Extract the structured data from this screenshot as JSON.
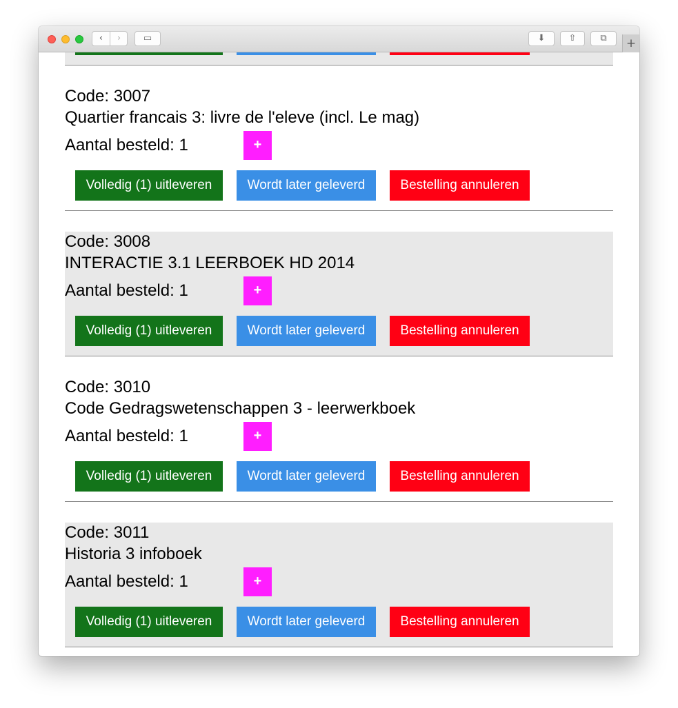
{
  "browser": {
    "nav_back_icon": "‹",
    "nav_forward_icon": "›",
    "sidebar_icon": "▭",
    "download_icon": "⬇",
    "share_icon": "⇧",
    "tabs_icon": "⧉",
    "new_tab_icon": "+"
  },
  "labels": {
    "code_prefix": "Code: ",
    "quantity_label": "Aantal besteld: ",
    "plus": "+",
    "issue_button": "Volledig (1) uitleveren",
    "later_button": "Wordt later geleverd",
    "cancel_button": "Bestelling annuleren"
  },
  "orders": [
    {
      "code": "",
      "title": "",
      "quantity": "",
      "shaded": true,
      "partial": true
    },
    {
      "code": "3007",
      "title": "Quartier francais 3: livre de l'eleve (incl. Le mag)",
      "quantity": "1",
      "shaded": false
    },
    {
      "code": "3008",
      "title": "INTERACTIE 3.1 LEERBOEK HD 2014",
      "quantity": "1",
      "shaded": true
    },
    {
      "code": "3010",
      "title": "Code Gedragswetenschappen 3 - leerwerkboek",
      "quantity": "1",
      "shaded": false
    },
    {
      "code": "3011",
      "title": "Historia 3 infoboek",
      "quantity": "1",
      "shaded": true
    }
  ],
  "colors": {
    "issue": "#13741a",
    "later": "#3a8fe6",
    "cancel": "#ff0014",
    "plus": "#ff1eff",
    "shaded_row": "#e8e8e8"
  }
}
